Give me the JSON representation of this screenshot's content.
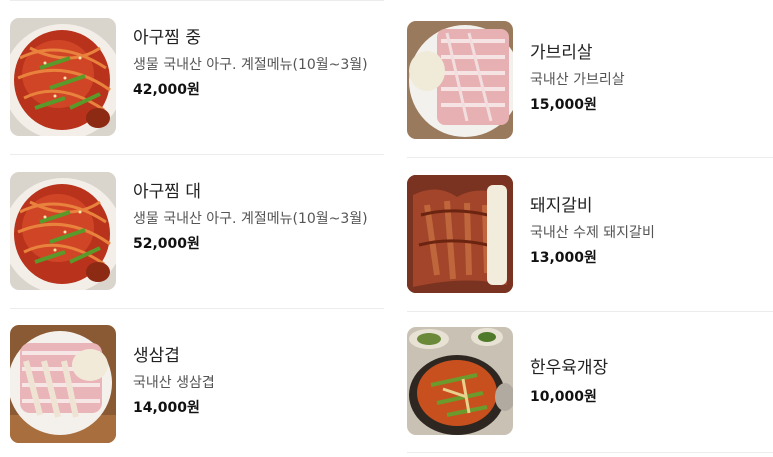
{
  "menu": {
    "left": [
      {
        "name": "아구찜 중",
        "description": "생물 국내산 아구. 계절메뉴(10월~3월)",
        "price": "42,000원",
        "image": "spicy-monkfish-photo"
      },
      {
        "name": "아구찜 대",
        "description": "생물 국내산 아구. 계절메뉴(10월~3월)",
        "price": "52,000원",
        "image": "spicy-monkfish-photo"
      },
      {
        "name": "생삼겹",
        "description": "국내산 생삼겹",
        "price": "14,000원",
        "image": "raw-pork-belly-photo"
      }
    ],
    "right": [
      {
        "name": "가브리살",
        "description": "국내산 가브리살",
        "price": "15,000원",
        "image": "pork-jowl-photo"
      },
      {
        "name": "돼지갈비",
        "description": "국내산 수제 돼지갈비",
        "price": "13,000원",
        "image": "marinated-pork-ribs-photo"
      },
      {
        "name": "한우육개장",
        "description": "",
        "price": "10,000원",
        "image": "beef-spicy-soup-photo"
      }
    ]
  },
  "colors": {
    "price": "#111111",
    "name": "#222222",
    "description": "#555555",
    "separator": "#ececec"
  }
}
